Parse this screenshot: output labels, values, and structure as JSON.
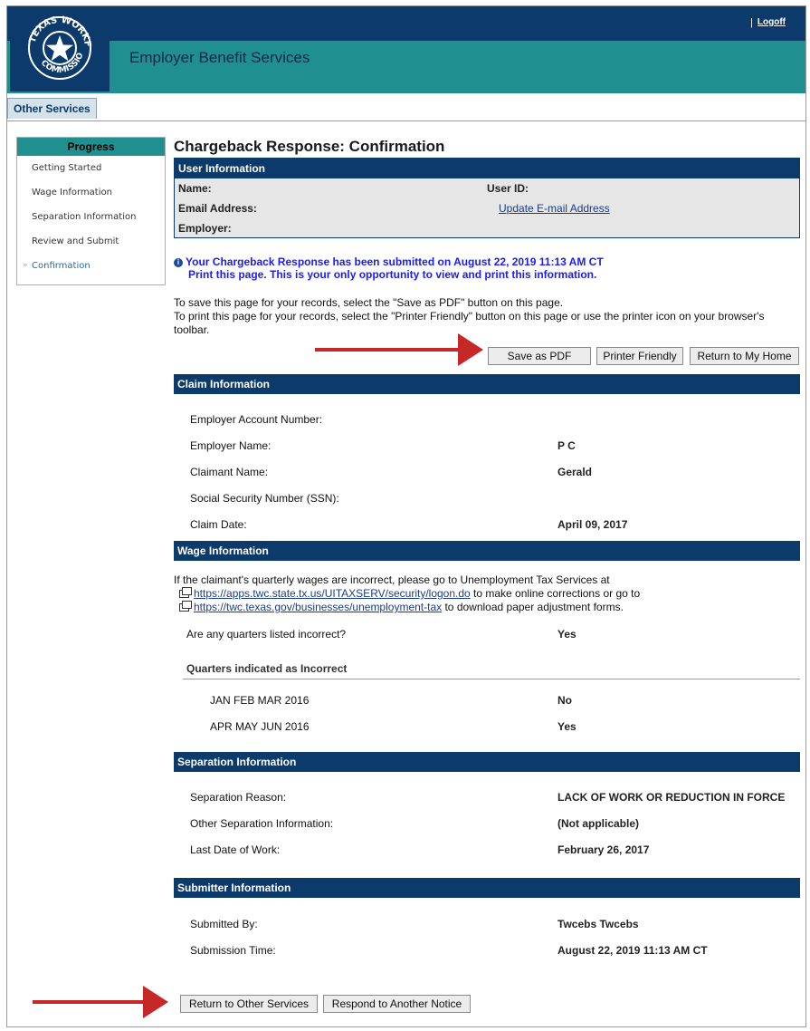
{
  "header": {
    "app_title": "Employer Benefit Services",
    "logo_text": "TEXAS WORKFORCE COMMISSION",
    "logoff_label": "Logoff",
    "separator": "|"
  },
  "tabs": [
    {
      "label": "Other Services"
    }
  ],
  "progress": {
    "title": "Progress",
    "items": [
      {
        "label": "Getting Started"
      },
      {
        "label": "Wage Information"
      },
      {
        "label": "Separation Information"
      },
      {
        "label": "Review and Submit"
      },
      {
        "label": "Confirmation",
        "current": true,
        "marker": "»"
      }
    ]
  },
  "page": {
    "title": "Chargeback Response: Confirmation"
  },
  "user_info": {
    "heading": "User Information",
    "name_label": "Name:",
    "user_id_label": "User ID:",
    "email_label": "Email Address:",
    "update_email_link": "Update E-mail Address",
    "employer_label": "Employer:"
  },
  "notice": {
    "line1": "Your Chargeback Response has been submitted on August 22, 2019 11:13 AM CT",
    "line2": "Print this page. This is your only opportunity to view and print this information."
  },
  "instructions": {
    "line1": "To save this page for your records, select the \"Save as PDF\" button on this page.",
    "line2": "To print this page for your records, select the \"Printer Friendly\" button on this page or use the printer icon on your browser's toolbar."
  },
  "actions_top": {
    "save_pdf": "Save as PDF",
    "printer_friendly": "Printer Friendly",
    "return_home": "Return to My Home"
  },
  "claim": {
    "heading": "Claim Information",
    "rows": [
      {
        "label": "Employer Account Number:",
        "value": ""
      },
      {
        "label": "Employer Name:",
        "value": "P C"
      },
      {
        "label": "Claimant Name:",
        "value": "Gerald"
      },
      {
        "label": "Social Security Number (SSN):",
        "value": ""
      },
      {
        "label": "Claim Date:",
        "value": "April 09, 2017"
      }
    ]
  },
  "wage": {
    "heading": "Wage Information",
    "intro": "If the claimant's quarterly wages are incorrect, please go to Unemployment Tax Services at",
    "link1": "https://apps.twc.state.tx.us/UITAXSERV/security/logon.do",
    "link1_suffix": " to make online corrections or go to",
    "link2": "https://twc.texas.gov/businesses/unemployment-tax",
    "link2_suffix": " to download paper adjustment forms.",
    "question": "Are any quarters listed incorrect?",
    "answer": "Yes",
    "quarters_heading": "Quarters indicated as Incorrect",
    "quarters": [
      {
        "label": "JAN FEB MAR 2016",
        "value": "No"
      },
      {
        "label": "APR MAY JUN 2016",
        "value": "Yes"
      }
    ]
  },
  "separation": {
    "heading": "Separation Information",
    "rows": [
      {
        "label": "Separation Reason:",
        "value": "LACK OF WORK OR REDUCTION IN FORCE"
      },
      {
        "label": "Other Separation Information:",
        "value": "(Not applicable)"
      },
      {
        "label": "Last Date of Work:",
        "value": "February 26, 2017"
      }
    ]
  },
  "submitter": {
    "heading": "Submitter Information",
    "rows": [
      {
        "label": "Submitted By:",
        "value": "Twcebs Twcebs"
      },
      {
        "label": "Submission Time:",
        "value": "August 22, 2019 11:13 AM CT"
      }
    ]
  },
  "actions_bottom": {
    "return_other": "Return to Other Services",
    "respond_another": "Respond to Another Notice"
  },
  "colors": {
    "navy": "#0b3a6b",
    "teal": "#1f8f8f",
    "arrow": "#c62828",
    "notice_text": "#1a1aff"
  }
}
